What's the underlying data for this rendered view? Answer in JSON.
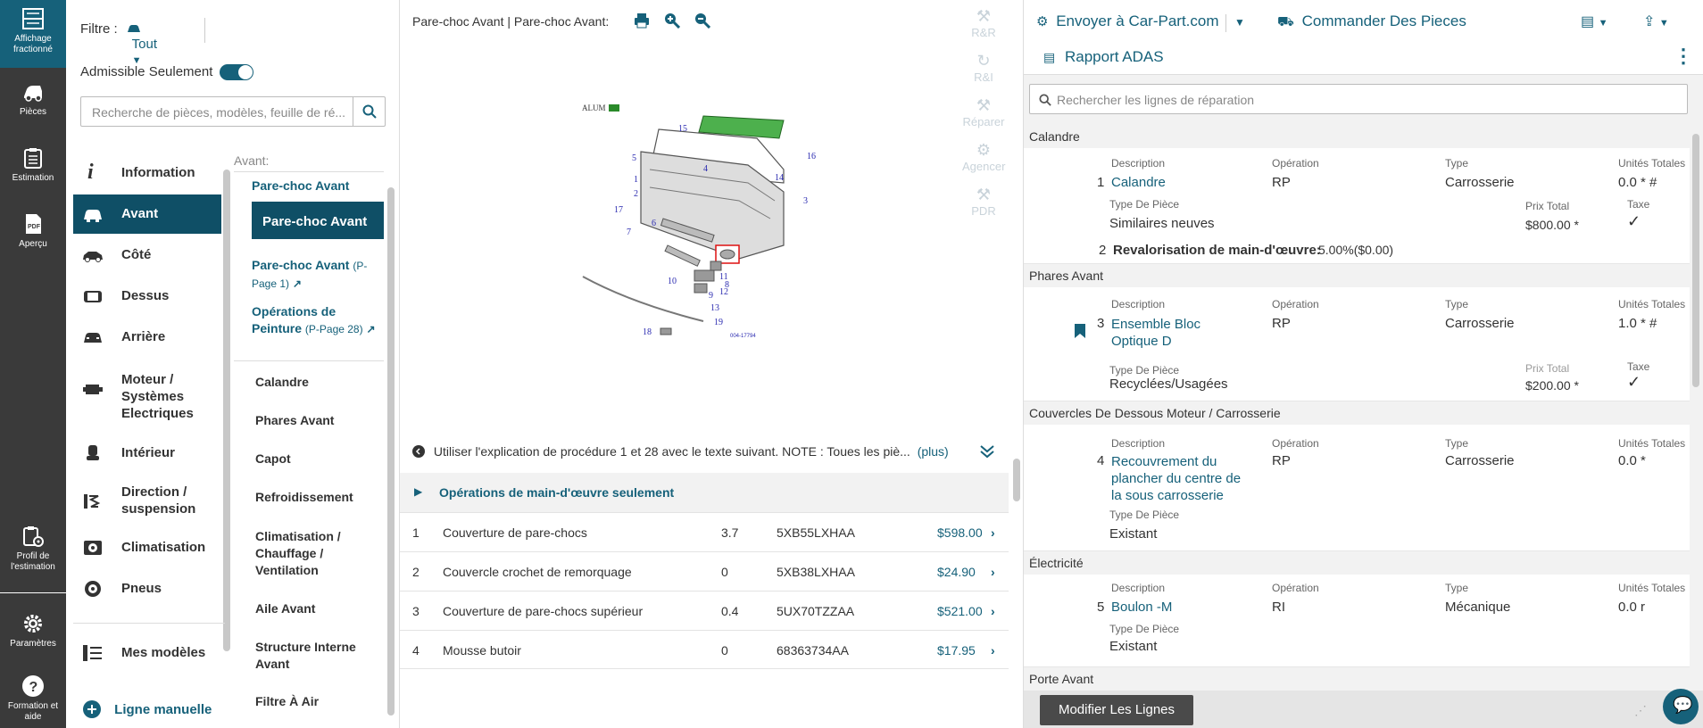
{
  "rail": {
    "items": [
      {
        "label1": "Affichage",
        "label2": "fractionné"
      },
      {
        "label1": "Pièces",
        "label2": ""
      },
      {
        "label1": "Estimation",
        "label2": ""
      },
      {
        "label1": "Aperçu",
        "label2": ""
      },
      {
        "label1": "Profil de",
        "label2": "l'estimation"
      },
      {
        "label1": "Paramètres",
        "label2": ""
      },
      {
        "label1": "Formation et",
        "label2": "aide"
      }
    ],
    "pdf_glyph": "PDF"
  },
  "nav": {
    "filter_label": "Filtre :",
    "filter_value": "Tout",
    "eligible_label": "Admissible Seulement",
    "search_placeholder": "Recherche de pièces, modèles, feuille de ré...",
    "categories": [
      {
        "label": "Information"
      },
      {
        "label": "Avant"
      },
      {
        "label": "Côté"
      },
      {
        "label": "Dessus"
      },
      {
        "label": "Arrière"
      },
      {
        "label": "Moteur / Systèmes Electriques"
      },
      {
        "label": "Intérieur"
      },
      {
        "label": "Direction / suspension"
      },
      {
        "label": "Climatisation"
      },
      {
        "label": "Pneus"
      }
    ],
    "my_models": "Mes modèles",
    "manual_line": "Ligne manuelle",
    "sub_header": "Avant:",
    "sub_selected_parent": "Pare-choc Avant",
    "sub_selected": "Pare-choc Avant",
    "sub_page_link": {
      "label": "Pare-choc Avant",
      "page": "(P-Page 1)"
    },
    "sub_paint_link": {
      "label": "Opérations de Peinture",
      "page": "(P-Page 28)"
    },
    "sub_items": [
      {
        "label": "Calandre"
      },
      {
        "label": "Phares Avant"
      },
      {
        "label": "Capot"
      },
      {
        "label": "Refroidissement"
      },
      {
        "label": "Climatisation / Chauffage / Ventilation"
      },
      {
        "label": "Aile Avant"
      },
      {
        "label": "Structure Interne Avant"
      },
      {
        "label": "Filtre À Air"
      }
    ]
  },
  "center": {
    "breadcrumb": "Pare-choc Avant | Pare-choc Avant:",
    "side_tools": [
      "R&R",
      "R&I",
      "Réparer",
      "Agencer",
      "PDR"
    ],
    "diagram_tag": "ALUM",
    "diagram_code": "004-17794",
    "diagram_callouts": [
      "15",
      "5",
      "1",
      "2",
      "17",
      "7",
      "6",
      "10",
      "11",
      "12",
      "13",
      "18",
      "19",
      "9",
      "8",
      "3",
      "4",
      "14",
      "16"
    ],
    "note": "Utiliser l'explication de procédure 1 et 28 avec le texte suivant. NOTE : Toues les piè...",
    "note_more": "(plus)",
    "labor_ops": "Opérations de main-d'œuvre seulement",
    "parts": [
      {
        "num": "1",
        "name": "Couverture de pare-chocs",
        "qty": "3.7",
        "code": "5XB55LXHAA",
        "price": "$598.00"
      },
      {
        "num": "2",
        "name": "Couvercle crochet de remorquage",
        "qty": "0",
        "code": "5XB38LXHAA",
        "price": "$24.90"
      },
      {
        "num": "3",
        "name": "Couverture de pare-chocs supérieur",
        "qty": "0.4",
        "code": "5UX70TZZAA",
        "price": "$521.00"
      },
      {
        "num": "4",
        "name": "Mousse butoir",
        "qty": "0",
        "code": "68363734AA",
        "price": "$17.95"
      }
    ]
  },
  "right": {
    "send": "Envoyer à Car-Part.com",
    "order": "Commander Des Pieces",
    "adas": "Rapport ADAS",
    "search_placeholder": "Rechercher les lignes de réparation",
    "headers": {
      "description": "Description",
      "operation": "Opération",
      "type": "Type",
      "units": "Unités Totales",
      "part_type": "Type De Pièce",
      "total_price": "Prix Total",
      "tax": "Taxe"
    },
    "sections": [
      {
        "title": "Calandre"
      },
      {
        "title": "Phares Avant"
      },
      {
        "title": "Couvercles De Dessous Moteur / Carrosserie"
      },
      {
        "title": "Électricité"
      },
      {
        "title": "Porte Avant"
      }
    ],
    "lines": [
      {
        "num": "1",
        "desc": "Calandre",
        "op": "RP",
        "type": "Carrosserie",
        "units": "0.0 * #",
        "part_type": "Similaires neuves",
        "price": "$800.00 *"
      },
      {
        "num": "2",
        "label": "Revalorisation de main-d'œuvre:",
        "value": "5.00%($0.00)"
      },
      {
        "num": "3",
        "desc": "Ensemble Bloc Optique D",
        "op": "RP",
        "type": "Carrosserie",
        "units": "1.0 * #",
        "part_type": "Recyclées/Usagées",
        "price": "$200.00 *"
      },
      {
        "num": "4",
        "desc": "Recouvrement du plancher du centre de la sous carrosserie",
        "op": "RP",
        "type": "Carrosserie",
        "units": "0.0 *",
        "part_type": "Existant"
      },
      {
        "num": "5",
        "desc": "Boulon -M",
        "op": "RI",
        "type": "Mécanique",
        "units": "0.0 r",
        "part_type": "Existant"
      }
    ],
    "modify_button": "Modifier Les Lignes"
  }
}
